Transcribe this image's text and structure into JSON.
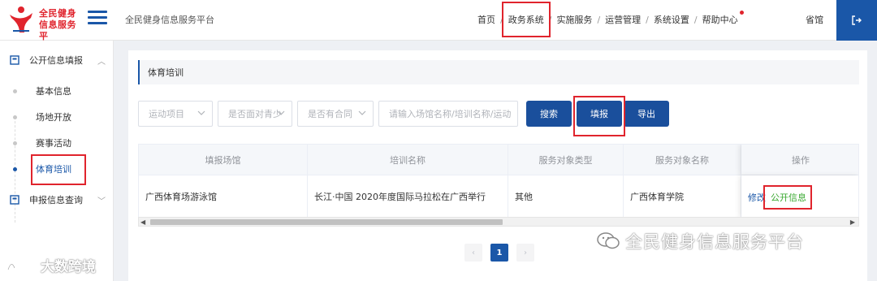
{
  "brand": {
    "logo_line1": "全民健身",
    "logo_line2": "信息服务平",
    "platform_title": "全民健身信息服务平台"
  },
  "topnav": {
    "items": [
      "首页",
      "政务系统",
      "实施服务",
      "运营管理",
      "系统设置",
      "帮助中心"
    ],
    "separator": "/",
    "user": "省馆"
  },
  "sidebar": {
    "group1_label": "公开信息填报",
    "sub_items": [
      "基本信息",
      "场地开放",
      "赛事活动",
      "体育培训"
    ],
    "group2_label": "申报信息查询"
  },
  "main": {
    "section_title": "体育培训",
    "filters": {
      "sport_placeholder": "运动项目",
      "public_placeholder": "是否面对青少",
      "contract_placeholder": "是否有合同",
      "search_placeholder": "请输入场馆名称/培训名称/运动"
    },
    "buttons": {
      "search": "搜索",
      "fill": "填报",
      "export": "导出"
    },
    "table": {
      "headers": [
        "填报场馆",
        "培训名称",
        "服务对象类型",
        "服务对象名称",
        "操作"
      ],
      "rows": [
        {
          "venue": "广西体育场游泳馆",
          "training": "长江·中国 2020年度国际马拉松在广西举行",
          "service_type": "其他",
          "service_name": "广西体育学院",
          "edit": "修改",
          "public": "公开信息"
        }
      ]
    },
    "pagination": {
      "prev": "‹",
      "current": "1",
      "next": "›"
    }
  },
  "watermarks": {
    "right": "全民健身信息服务平台",
    "left": "大数跨境"
  },
  "colors": {
    "primary": "#1a57a8",
    "button": "#1a4f9c",
    "highlight_box": "#e0242d",
    "link_green": "#3aa831"
  }
}
